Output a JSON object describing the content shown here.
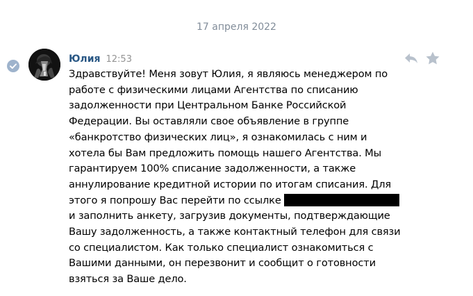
{
  "date_separator": "17 апреля 2022",
  "message": {
    "author": "Юлия",
    "time": "12:53",
    "text_before_redaction": "Здравствуйте! Меня зовут Юлия, я являюсь менеджером по\nработе с физическими лицами Агентства по списанию\nзадолженности при Центральном Банке Российской\nФедерации. Вы оставляли свое объявление в группе\n«банкротство физических лиц», я ознакомилась с ним и\nхотела бы Вам предложить помощь нашего Агентства. Мы\nгарантируем 100% списание задолженности, а также\nаннулирование кредитной истории по итогам списания. Для\nэтого я попрошу Вас перейти по ссылке",
    "text_after_redaction": "\nи заполнить анкету, загрузив документы, подтверждающие\nВашу задолженность, а также контактный телефон для связи\nсо специалистом. Как только специалист ознакомиться с\nВашими данными, он перезвонит и сообщит о готовности\nвзяться за Ваше дело."
  },
  "icons": {
    "read_status": "check-circle-icon",
    "reply": "reply-arrow-icon",
    "favorite": "star-icon",
    "avatar": "user-avatar-photo"
  },
  "colors": {
    "author": "#2a5885",
    "meta": "#939393",
    "date": "#818c99",
    "check_circle": "#9eb3cc",
    "action_icons": "#b8c1cc",
    "redaction": "#000000"
  }
}
